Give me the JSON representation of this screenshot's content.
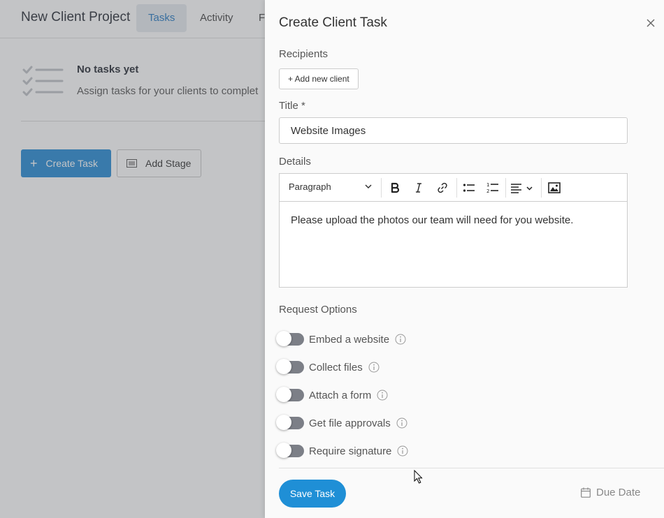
{
  "background": {
    "project_title": "New Client Project",
    "tabs": [
      {
        "label": "Tasks",
        "active": true
      },
      {
        "label": "Activity",
        "active": false
      },
      {
        "label": "F",
        "active": false
      }
    ],
    "empty_state": {
      "title": "No tasks yet",
      "subtitle": "Assign tasks for your clients to complet"
    },
    "create_task_label": "Create Task",
    "add_stage_label": "Add Stage",
    "accent_color": "#3a95d8"
  },
  "panel": {
    "title": "Create Client Task",
    "recipients_label": "Recipients",
    "add_client_label": "+ Add new client",
    "title_label": "Title *",
    "title_value": "Website Images",
    "details_label": "Details",
    "editor": {
      "block_format": "Paragraph",
      "content": "Please upload the photos our team will need for you website.",
      "toolbar_icons": [
        "bold-icon",
        "italic-icon",
        "link-icon",
        "bullet-list-icon",
        "numbered-list-icon",
        "align-icon",
        "image-icon"
      ]
    },
    "request_options_label": "Request Options",
    "options": [
      {
        "label": "Embed a website",
        "enabled": false
      },
      {
        "label": "Collect files",
        "enabled": false
      },
      {
        "label": "Attach a form",
        "enabled": false
      },
      {
        "label": "Get file approvals",
        "enabled": false
      },
      {
        "label": "Require signature",
        "enabled": false
      }
    ],
    "save_label": "Save Task",
    "due_date_label": "Due Date",
    "save_color": "#1f8fd6"
  }
}
